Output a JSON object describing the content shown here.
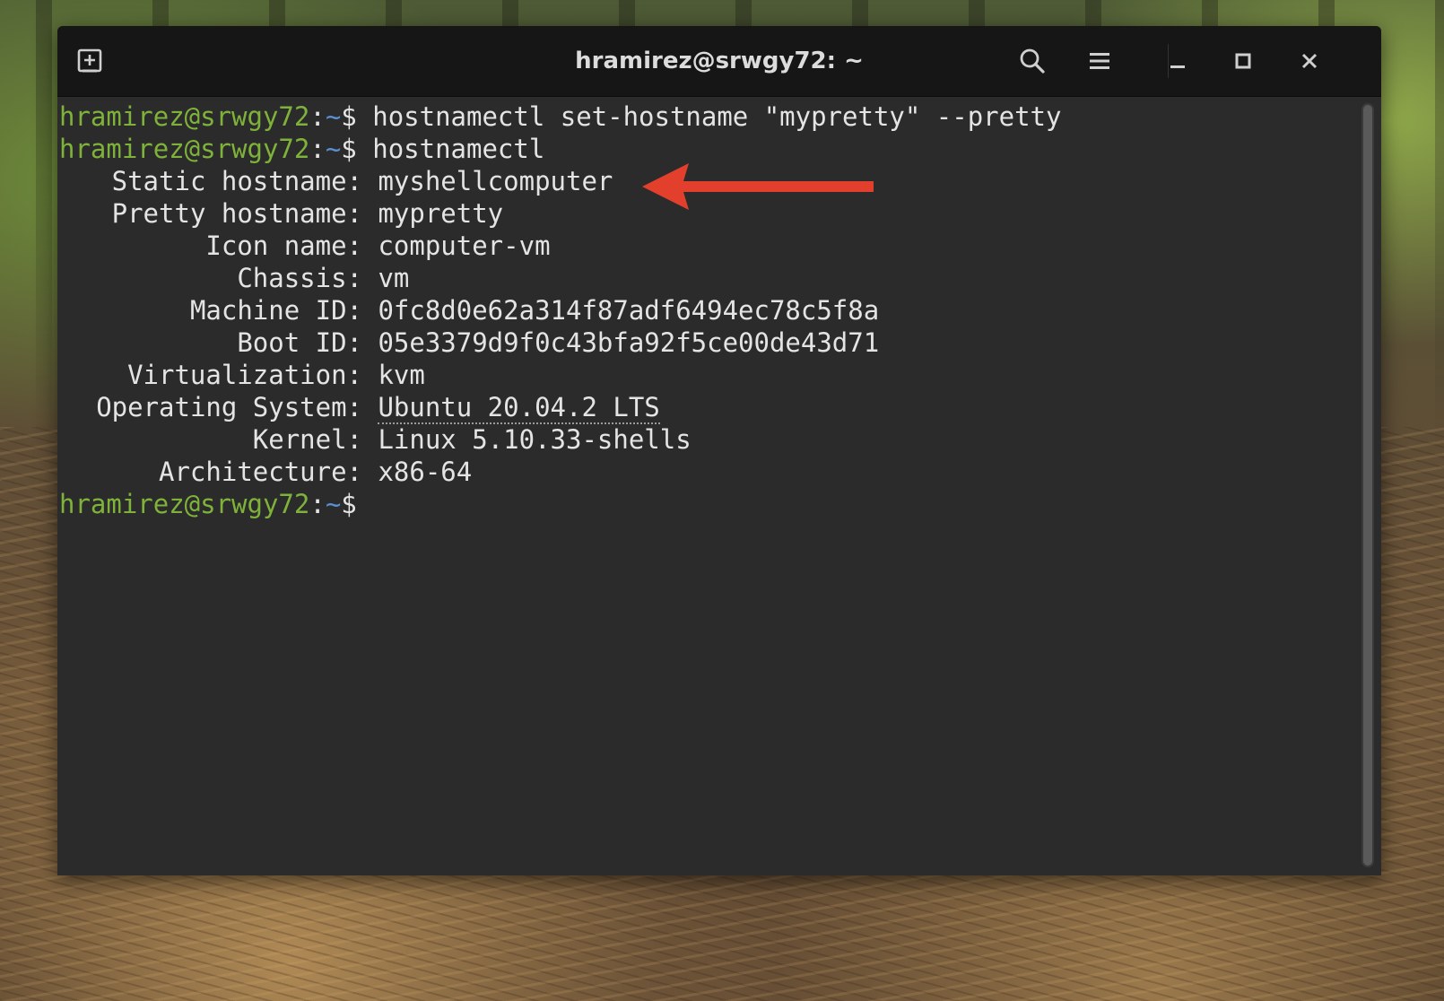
{
  "window": {
    "title": "hramirez@srwgy72: ~"
  },
  "titlebar": {
    "new_tab_icon": "new-tab-icon",
    "search_icon": "search-icon",
    "menu_icon": "hamburger-menu-icon",
    "minimize_icon": "minimize-icon",
    "maximize_icon": "maximize-icon",
    "close_icon": "close-icon"
  },
  "colors": {
    "prompt_user": "#7fb23a",
    "prompt_path": "#5b8fd0",
    "terminal_bg": "#2b2b2b",
    "titlebar_bg": "#161616",
    "annotation_arrow": "#e2402c"
  },
  "terminal": {
    "prompt": {
      "user_host": "hramirez@srwgy72",
      "colon": ":",
      "path": "~",
      "symbol": "$"
    },
    "commands": [
      "hostnamectl set-hostname \"mypretty\" --pretty",
      "hostnamectl"
    ],
    "output": [
      {
        "label": "Static hostname:",
        "value": "myshellcomputer"
      },
      {
        "label": "Pretty hostname:",
        "value": "mypretty"
      },
      {
        "label": "Icon name:",
        "value": "computer-vm"
      },
      {
        "label": "Chassis:",
        "value": "vm"
      },
      {
        "label": "Machine ID:",
        "value": "0fc8d0e62a314f87adf6494ec78c5f8a"
      },
      {
        "label": "Boot ID:",
        "value": "05e3379d9f0c43bfa92f5ce00de43d71"
      },
      {
        "label": "Virtualization:",
        "value": "kvm"
      },
      {
        "label": "Operating System:",
        "value": "Ubuntu 20.04.2 LTS"
      },
      {
        "label": "Kernel:",
        "value": "Linux 5.10.33-shells"
      },
      {
        "label": "Architecture:",
        "value": "x86-64"
      }
    ]
  },
  "annotation": {
    "arrow_icon": "red-arrow-left-icon"
  }
}
